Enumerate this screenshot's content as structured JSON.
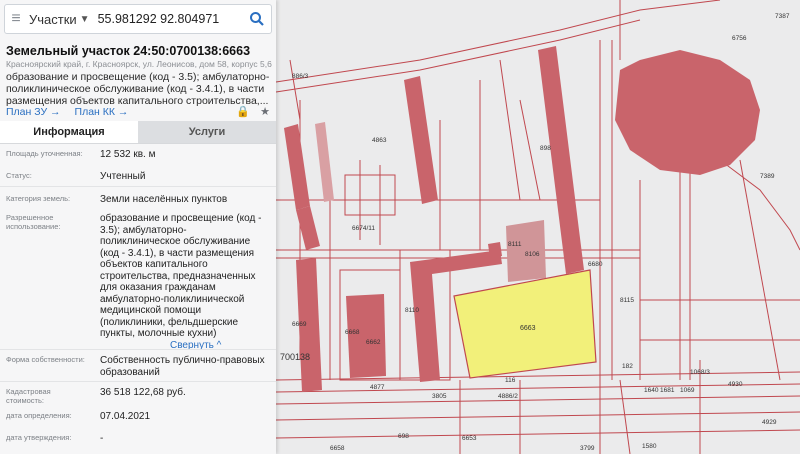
{
  "search": {
    "mode": "Участки",
    "query": "55.981292 92.804971"
  },
  "parcel": {
    "title": "Земельный участок 24:50:0700138:6663",
    "address": "Красноярский край, г. Красноярск, ул. Леонисов, дом 58, корпус 5,6",
    "purpose_lines": [
      "образование и просвещение (код - 3.5); амбулаторно-",
      "поликлиническое обслуживание (код - 3.4.1), в части",
      "размещения объектов капитального строительства,..."
    ],
    "plan_zu": "План ЗУ →",
    "plan_kk": "План КК →"
  },
  "tabs": [
    "Информация",
    "Услуги"
  ],
  "info": {
    "area_label": "Площадь уточненная:",
    "area_value": "12 532 кв. м",
    "status_label": "Статус:",
    "status_value": "Учтенный",
    "category_label": "Категория земель:",
    "category_value": "Земли населённых пунктов",
    "use_label": "Разрешенное использование:",
    "use_lines": [
      "образование и просвещение (код -",
      "3.5); амбулаторно-",
      "поликлиническое обслуживание",
      "(код - 3.4.1), в части размещения",
      "объектов капитального",
      "строительства, предназначенных",
      "для оказания гражданам",
      "амбулаторно-поликлинической",
      "медицинской помощи",
      "(поликлиники, фельдшерские",
      "пункты, молочные кухни)"
    ],
    "collapse": "Свернуть ^",
    "ownership_label": "Форма собственности:",
    "ownership_lines": [
      "Собственность публично-правовых",
      "образований"
    ],
    "cadastral_label": "Кадастровая стоимость:",
    "cadastral_value": "36 518 122,68 руб.",
    "date_def_label": "дата определения:",
    "date_def_value": "07.04.2021",
    "date_appr_label": "дата утверждения:",
    "date_appr_value": "-"
  },
  "map_labels": {
    "parcel": "6663",
    "p7387": "7387",
    "p6756": "6756",
    "p8663": "886/3",
    "p4863": "4863",
    "p898": "898",
    "p7389": "7389",
    "p6674": "6674/11",
    "p8111": "8111",
    "p8106": "8106",
    "p6680": "6680",
    "p8115": "8115",
    "p6669": "6669",
    "p6668": "6668",
    "p6662": "6662",
    "p8110": "8110",
    "p700138": "700138",
    "p4877": "4877",
    "p3805": "3805",
    "p116": "116",
    "p4886": "4886/2",
    "p182": "182",
    "p1068": "1068/3",
    "p4930": "4930",
    "p1069": "1069",
    "p1681": "1681",
    "p1640": "1640",
    "p4929": "4929",
    "p6658": "6658",
    "p698": "698",
    "p6653": "6653",
    "p3799": "3799",
    "p1580": "1580"
  },
  "colors": {
    "parcel_fill": "#f2f07a",
    "building": "#c9646b",
    "lines": "#c0484f"
  }
}
